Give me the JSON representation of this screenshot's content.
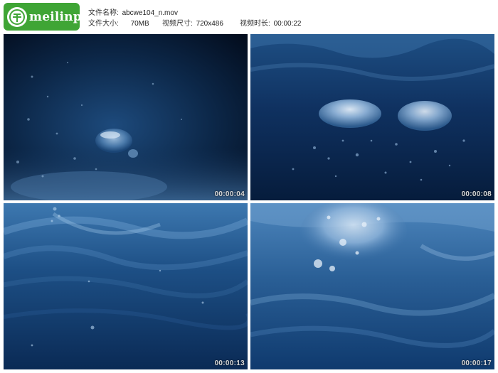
{
  "logo": {
    "text": "meilinps",
    "color": "#3fa535"
  },
  "file_info": {
    "name_label": "文件名称:",
    "name_value": "abcwe104_n.mov",
    "size_label": "文件大小:",
    "size_value": "70MB",
    "dims_label": "视频尺寸:",
    "dims_value": "720x486",
    "duration_label": "视频时长:",
    "duration_value": "00:00:22"
  },
  "thumbnails": [
    {
      "timestamp": "00:00:04",
      "scene": "underwater-bubble-dark"
    },
    {
      "timestamp": "00:00:08",
      "scene": "underwater-bubbles-pair"
    },
    {
      "timestamp": "00:00:13",
      "scene": "underwater-surface-waves"
    },
    {
      "timestamp": "00:00:17",
      "scene": "underwater-surface-bright"
    }
  ]
}
